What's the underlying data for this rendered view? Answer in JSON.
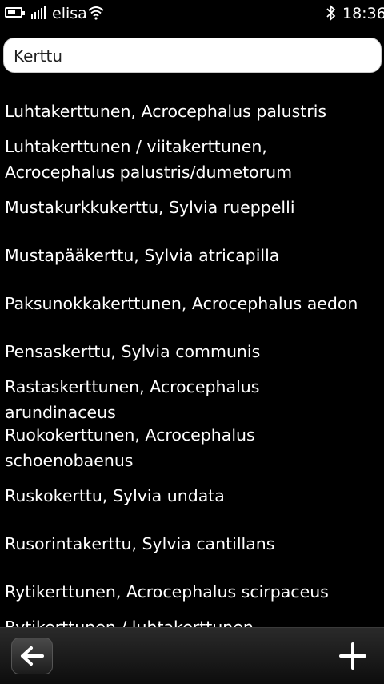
{
  "status_bar": {
    "carrier": "elisa",
    "time": "18:36",
    "icons": [
      "battery-icon",
      "signal-strength-icon",
      "wifi-icon",
      "bluetooth-icon"
    ]
  },
  "search": {
    "value": "Kerttu"
  },
  "results": [
    "Luhtakerttunen, Acrocephalus palustris",
    "Luhtakerttunen / viitakerttunen,\nAcrocephalus palustris/dumetorum",
    "Mustakurkkukerttu, Sylvia rueppelli",
    "Mustapääkerttu, Sylvia atricapilla",
    "Paksunokkakerttunen, Acrocephalus aedon",
    "Pensaskerttu, Sylvia communis",
    "Rastaskerttunen, Acrocephalus\narundinaceus",
    "Ruokokerttunen, Acrocephalus\nschoenobaenus",
    "Ruskokerttu, Sylvia undata",
    "Rusorintakerttu, Sylvia cantillans",
    "Rytikerttunen, Acrocephalus scirpaceus",
    "Rytikerttunen / luhtakerttunen"
  ],
  "toolbar": {
    "icons": [
      "back-arrow-icon",
      "add-icon"
    ]
  }
}
